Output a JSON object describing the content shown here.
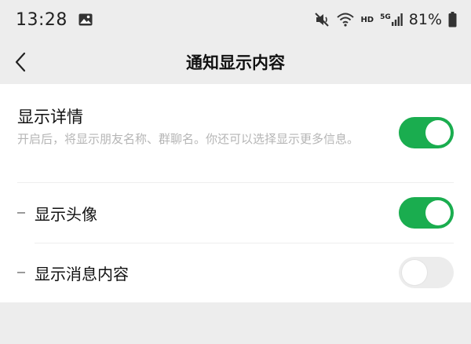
{
  "status_bar": {
    "time": "13:28",
    "battery": "81%",
    "hd_label": "HD",
    "network_label": "5G"
  },
  "nav": {
    "title": "通知显示内容"
  },
  "settings": {
    "detail": {
      "title": "显示详情",
      "description": "开启后，将显示朋友名称、群聊名。你还可以选择显示更多信息。",
      "enabled": true
    },
    "avatar": {
      "label": "显示头像",
      "enabled": true
    },
    "message_content": {
      "label": "显示消息内容",
      "enabled": false
    }
  },
  "colors": {
    "toggle_on": "#1aad4f",
    "toggle_off": "#ececec",
    "background": "#ededed"
  }
}
